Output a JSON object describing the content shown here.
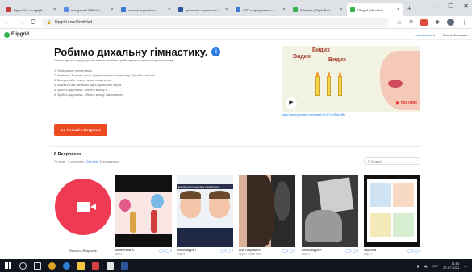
{
  "browser": {
    "tabs": [
      {
        "label": "Відео 3.0 – слідкуй...",
        "color": "#c43a3a",
        "active": false
      },
      {
        "label": "вся урочий 2020-2...",
        "color": "#5a8de0",
        "active": false
      },
      {
        "label": "спотивна дихання",
        "color": "#3a7bd5",
        "active": false
      },
      {
        "label": "дихання і нервова сі...",
        "color": "#2b579a",
        "active": false
      },
      {
        "label": "СТР з підгрупами з ...",
        "color": "#3a7bd5",
        "active": false
      },
      {
        "label": "Educator | Topic Det...",
        "color": "#36b34c",
        "active": false
      },
      {
        "label": "Flipgrid | Scrollbar",
        "color": "#36b34c",
        "active": true
      }
    ],
    "new_tab": "+",
    "window_controls": [
      "—",
      "☐",
      "✕"
    ],
    "url": "flipgrid.com/3cefdfad",
    "nav": [
      "←",
      "→",
      "C",
      "⌂"
    ],
    "ext_icons": [
      "☆",
      "⚲"
    ]
  },
  "flipgrid": {
    "logo": "Flipgrid",
    "join": "Join Activated",
    "user": "Ольга Миткова ▾"
  },
  "topic": {
    "title": "Робимо дихальну гімнастику.",
    "info_icon": "i",
    "subtitle": "Уявіть, що ви перед пустою кімнатою. Вам треба провести дихальну гімнастику.",
    "steps": [
      "1. Перегляньте презентацію.",
      "2. Натисніть 3 кнопки, які ви будете говорити, наприклад. Дихайте глибоко!",
      "3. Використайте кожну вправу кілька разів.",
      "4. Кожного з вас записати відео, дихальних вправ.",
      "5. Зробіть відеозапис. Оберіть кнопку з ...",
      "6. Зробіть відеозапис. Оберіть кнопку Завантажити."
    ],
    "video": {
      "words": [
        "Видих",
        "Видих",
        "Видих"
      ],
      "play_icon": "▶",
      "youtube_label": "▶ YouTube"
    },
    "video_link": "https://www.youtube.com/watch?v=F7rxlZBkrzBM",
    "reply_button": "Record a Response"
  },
  "responses": {
    "title": "6 Responses",
    "meta_prefix": "75 views · 2 comments ·",
    "meta_link": "Get more",
    "meta_suffix": "15 engagement",
    "search_placeholder": "Search",
    "record_label": "Record a Response",
    "cards": [
      {
        "name": "Валентина А.",
        "sub": "Nov 21",
        "views": "◯ 2 ◯ 2"
      },
      {
        "name": "Олександра Т",
        "sub": "Sep 19",
        "views": "◯ 2 ◯ 2"
      },
      {
        "name": "Аня Петрова М",
        "sub": "Sep 21 · Save Ukra",
        "views": "◯ 2 ◯ 2"
      },
      {
        "name": "Олександра Р",
        "sub": "Sep 21",
        "views": "◯ 2 ◯ 2"
      },
      {
        "name": "Ярослав Т",
        "sub": "Sep 21",
        "views": "◯ 2 ◯ 2"
      }
    ],
    "card2_banner": "Exercise from Exercises Label France"
  },
  "taskbar": {
    "time": "11:50",
    "date": "27.07.2021",
    "lang": "УКР",
    "apps": [
      {
        "name": "search",
        "color": "#ffffff"
      },
      {
        "name": "task-view",
        "color": "#ffffff"
      },
      {
        "name": "chrome",
        "color": "#e0a32a"
      },
      {
        "name": "edge",
        "color": "#2b7cd3"
      },
      {
        "name": "explorer",
        "color": "#f4c542"
      },
      {
        "name": "photo-app",
        "color": "#d63f3f"
      },
      {
        "name": "video-app",
        "color": "#e6e6e6"
      },
      {
        "name": "app-blue",
        "color": "#2b579a"
      }
    ]
  }
}
